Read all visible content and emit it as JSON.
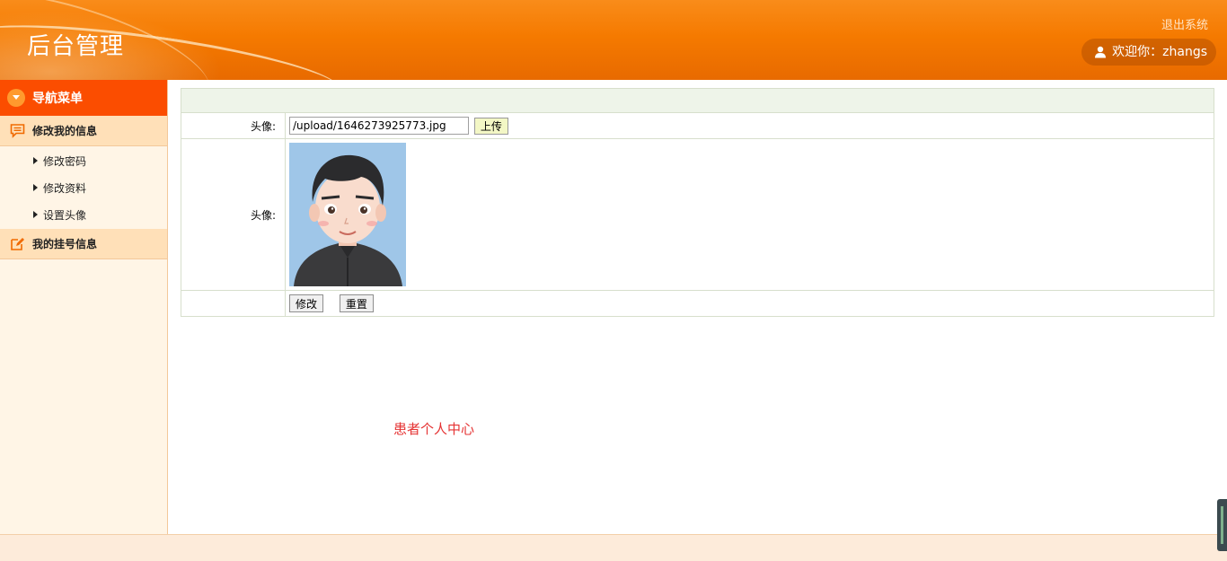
{
  "header": {
    "title": "后台管理",
    "logout": "退出系统",
    "welcome": "欢迎你：zhangs"
  },
  "sidebar": {
    "nav_title": "导航菜单",
    "groups": [
      {
        "label": "修改我的信息",
        "items": [
          {
            "label": "修改密码"
          },
          {
            "label": "修改资料"
          },
          {
            "label": "设置头像"
          }
        ]
      },
      {
        "label": "我的挂号信息",
        "items": []
      }
    ]
  },
  "form": {
    "row1_label": "头像:",
    "path_value": "/upload/1646273925773.jpg",
    "upload_label": "上传",
    "row2_label": "头像:",
    "avatar_description": "avatar-portrait",
    "submit_label": "修改",
    "reset_label": "重置"
  },
  "page_note": "患者个人中心",
  "colors": {
    "header_orange": "#f57a00",
    "nav_head": "#fb4d00",
    "sidebar_bg": "#fff5e6",
    "group_bg": "#ffe0b8",
    "note_red": "#e53333"
  }
}
